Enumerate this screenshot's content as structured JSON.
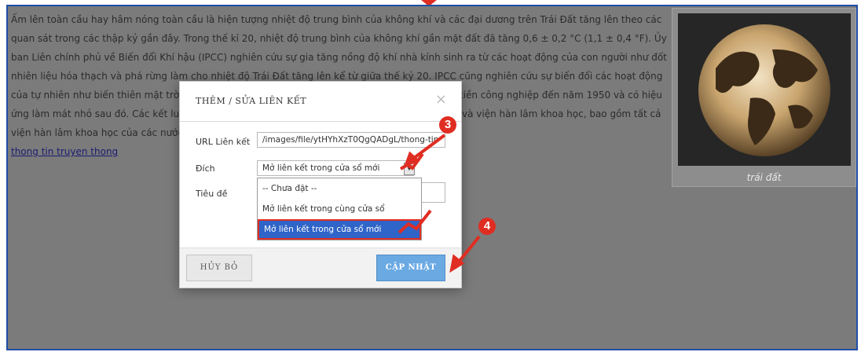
{
  "article": {
    "paragraph": "Ấm lên toàn cầu hay hâm nóng toàn cầu là hiện tượng nhiệt độ trung bình của không khí và các đại dương trên Trái Đất tăng lên theo các quan sát trong các thập kỷ gần đây. Trong thế kỉ 20, nhiệt độ trung bình của không khí gần mặt đất đã tăng 0,6 ± 0,2 °C (1,1 ± 0,4 °F). Ủy ban Liên chính phủ về Biến đổi Khí hậu (IPCC) nghiên cứu sự gia tăng nồng độ khí nhà kính sinh ra từ các hoạt động của con người như đốt nhiên liệu hóa thạch và phá rừng làm cho nhiệt độ Trái Đất tăng lên kể từ giữa thế kỷ 20. IPCC cũng nghiên cứu sự biến đổi các hoạt động của tự nhiên như biến thiên mặt trời và núi lửa gây ra phần lớn hiện tượng ấm lên từ giai đoạn tiền công nghiệp đến năm 1950 và có hiệu ứng làm mát nhỏ sau đó. Các kết luận cơ bản đã được chứng thực bởi hơn 45 tổ chức khoa học và viện hàn lâm khoa học, bao gồm tất cả viện hàn lâm khoa học của các nước công nghiệp hàng đầu.",
    "link_text": "thong tin truyen thong"
  },
  "figure": {
    "caption": "trái đất"
  },
  "dialog": {
    "title": "THÊM / SỬA LIÊN KẾT",
    "close_symbol": "×",
    "url_label": "URL Liên kết",
    "url_value": "/images/file/ytHYhXzT0QgQADgL/thong-tin",
    "target_label": "Đích",
    "target_selected": "Mở liên kết trong cửa sổ mới",
    "title_label": "Tiêu đề",
    "options": [
      "-- Chưa đặt --",
      "Mở liên kết trong cùng cửa sổ",
      "Mở liên kết trong cửa sổ mới"
    ],
    "cancel_label": "HỦY BỎ",
    "update_label": "CẬP NHẬT"
  },
  "annotations": {
    "step3": "3",
    "step4": "4"
  },
  "colors": {
    "annotation_red": "#e02d22",
    "selected_blue": "#2f64c8",
    "update_button": "#6aa9e2",
    "frame_border": "#1f4fa7"
  }
}
